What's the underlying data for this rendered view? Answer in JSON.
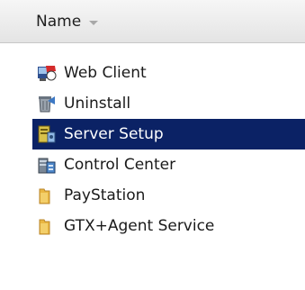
{
  "header": {
    "name_column_label": "Name",
    "sort_icon": "sort-desc-icon"
  },
  "files": [
    {
      "label": "Web Client",
      "icon": "web-client-icon",
      "selected": false
    },
    {
      "label": "Uninstall",
      "icon": "uninstall-icon",
      "selected": false
    },
    {
      "label": "Server Setup",
      "icon": "server-setup-icon",
      "selected": true
    },
    {
      "label": "Control Center",
      "icon": "control-center-icon",
      "selected": false
    },
    {
      "label": "PayStation",
      "icon": "folder-icon",
      "selected": false
    },
    {
      "label": "GTX+Agent Service",
      "icon": "folder-icon",
      "selected": false
    }
  ],
  "colors": {
    "selection_background": "#0b2265",
    "selection_text": "#ffffff",
    "folder_yellow": "#e9b642"
  }
}
